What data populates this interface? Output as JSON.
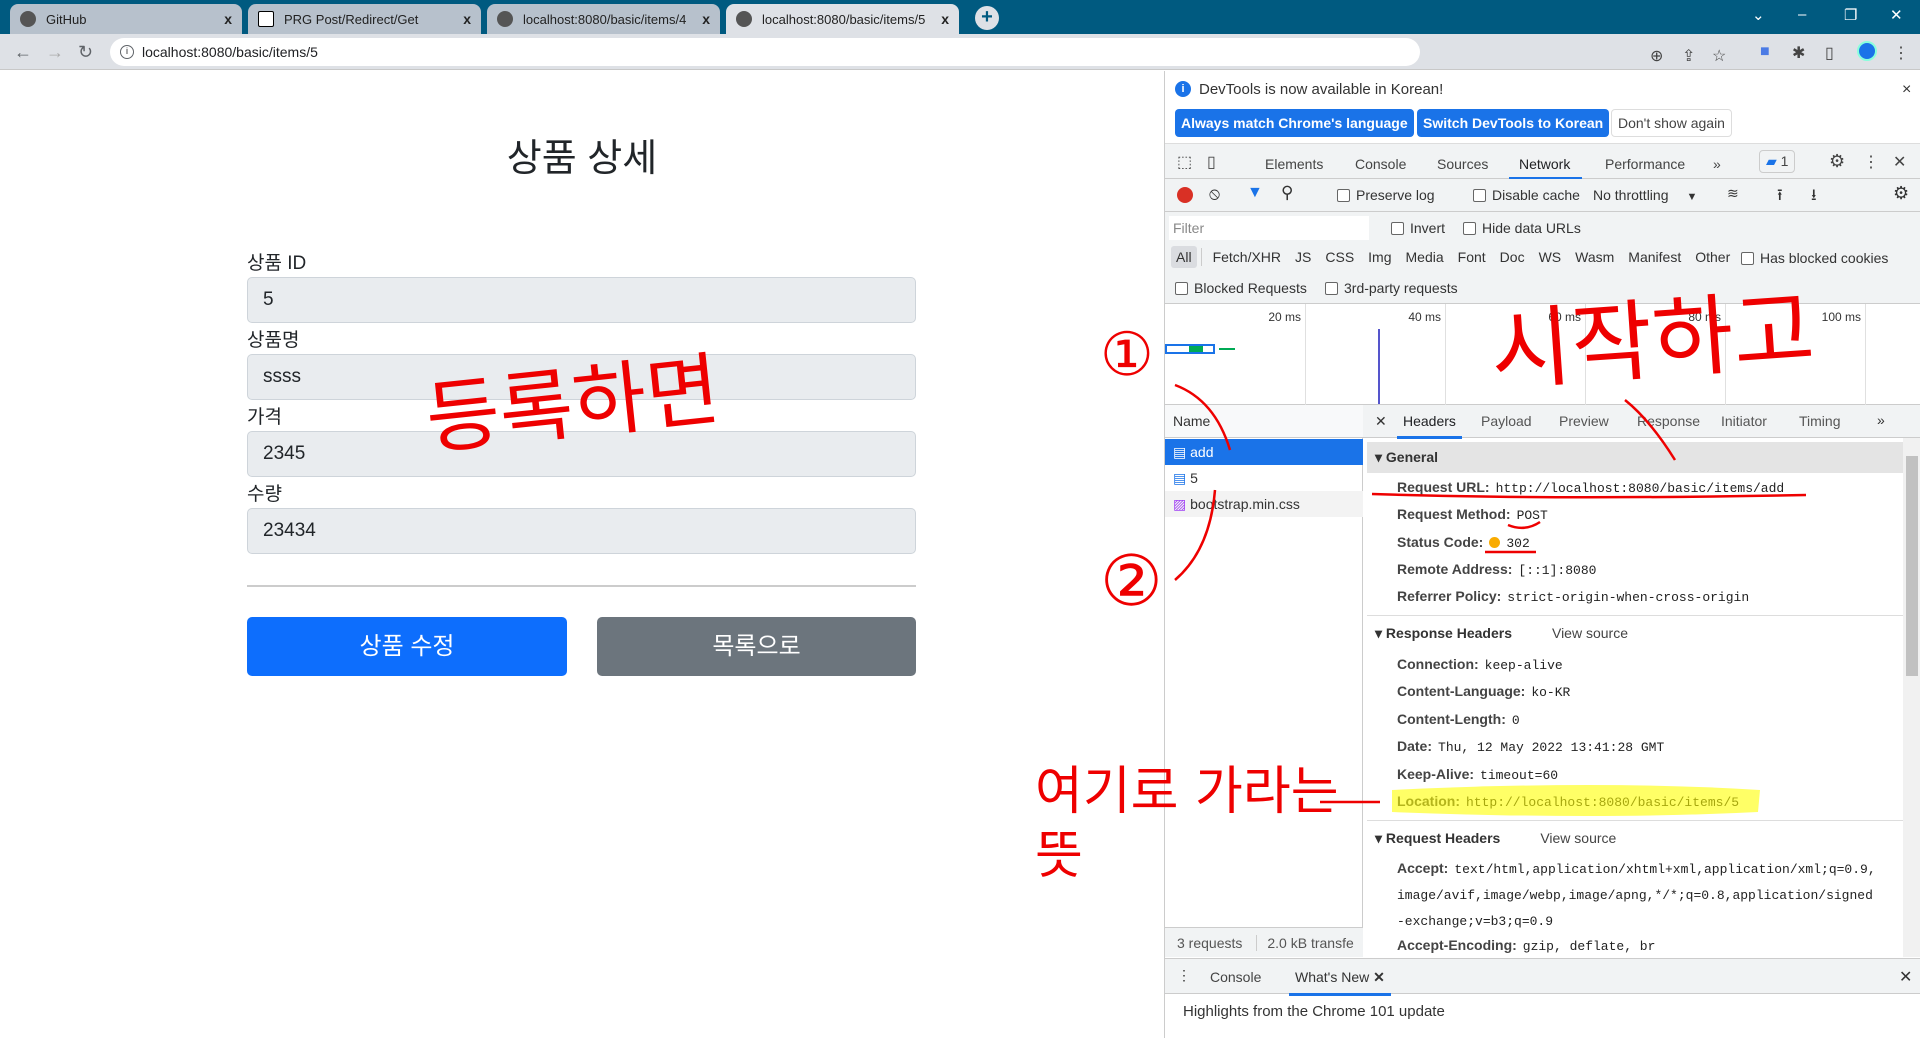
{
  "browser": {
    "tabs": [
      {
        "label": "GitHub"
      },
      {
        "label": "PRG Post/Redirect/Get"
      },
      {
        "label": "localhost:8080/basic/items/4"
      },
      {
        "label": "localhost:8080/basic/items/5"
      }
    ],
    "new_tab": "+",
    "close": "x",
    "url": "localhost:8080/basic/items/5",
    "window": {
      "dropdown": "⌄",
      "minimize": "–",
      "restore": "❐",
      "close": "✕"
    }
  },
  "page": {
    "title": "상품 상세",
    "fields": [
      {
        "label": "상품 ID",
        "value": "5"
      },
      {
        "label": "상품명",
        "value": "ssss"
      },
      {
        "label": "가격",
        "value": "2345"
      },
      {
        "label": "수량",
        "value": "23434"
      }
    ],
    "edit_button": "상품 수정",
    "list_button": "목록으로",
    "primary_color": "#0d6efd",
    "secondary_color": "#6c757d"
  },
  "devtools": {
    "infobar": {
      "message": "DevTools is now available in Korean!",
      "btn1": "Always match Chrome's language",
      "btn2": "Switch DevTools to Korean",
      "btn3": "Don't show again"
    },
    "tabs": [
      "Elements",
      "Console",
      "Sources",
      "Network",
      "Performance"
    ],
    "more": "»",
    "issues_count": "1",
    "toolbar": {
      "preserve_log": "Preserve log",
      "disable_cache": "Disable cache",
      "throttling": "No throttling"
    },
    "filter": {
      "placeholder": "Filter",
      "invert": "Invert",
      "hide_data_urls": "Hide data URLs"
    },
    "types": [
      "All",
      "Fetch/XHR",
      "JS",
      "CSS",
      "Img",
      "Media",
      "Font",
      "Doc",
      "WS",
      "Wasm",
      "Manifest",
      "Other"
    ],
    "has_blocked_cookies": "Has blocked cookies",
    "blocked_requests": "Blocked Requests",
    "third_party": "3rd-party requests",
    "timeline_ticks": [
      "20 ms",
      "40 ms",
      "60 ms",
      "80 ms",
      "100 ms"
    ],
    "name_header": "Name",
    "requests": [
      {
        "name": "add"
      },
      {
        "name": "5"
      },
      {
        "name": "bootstrap.min.css"
      }
    ],
    "status": {
      "requests": "3 requests",
      "transferred": "2.0 kB transfe"
    },
    "detail_tabs": [
      "Headers",
      "Payload",
      "Preview",
      "Response",
      "Initiator",
      "Timing"
    ],
    "general": {
      "title": "General",
      "rows": [
        {
          "k": "Request URL:",
          "v": "http://localhost:8080/basic/items/add"
        },
        {
          "k": "Request Method:",
          "v": "POST"
        },
        {
          "k": "Status Code:",
          "v": "302"
        },
        {
          "k": "Remote Address:",
          "v": "[::1]:8080"
        },
        {
          "k": "Referrer Policy:",
          "v": "strict-origin-when-cross-origin"
        }
      ]
    },
    "response_headers": {
      "title": "Response Headers",
      "view_source": "View source",
      "rows": [
        {
          "k": "Connection:",
          "v": "keep-alive"
        },
        {
          "k": "Content-Language:",
          "v": "ko-KR"
        },
        {
          "k": "Content-Length:",
          "v": "0"
        },
        {
          "k": "Date:",
          "v": "Thu, 12 May 2022 13:41:28 GMT"
        },
        {
          "k": "Keep-Alive:",
          "v": "timeout=60"
        },
        {
          "k": "Location:",
          "v": "http://localhost:8080/basic/items/5"
        }
      ]
    },
    "request_headers": {
      "title": "Request Headers",
      "view_source": "View source",
      "accept_key": "Accept:",
      "accept_lines": [
        "text/html,application/xhtml+xml,application/xml;q=0.9,",
        "image/avif,image/webp,image/apng,*/*;q=0.8,application/signed",
        "-exchange;v=b3;q=0.9"
      ],
      "encoding_key": "Accept-Encoding:",
      "encoding_val": "gzip, deflate, br"
    },
    "drawer": {
      "tabs": [
        "Console",
        "What's New"
      ],
      "highlight": "Highlights from the Chrome 101 update"
    }
  },
  "annotations": {
    "register": "등록하면",
    "start": "시작하고",
    "one": "①",
    "two": "②",
    "means": "여기로 가라는 뜻"
  }
}
